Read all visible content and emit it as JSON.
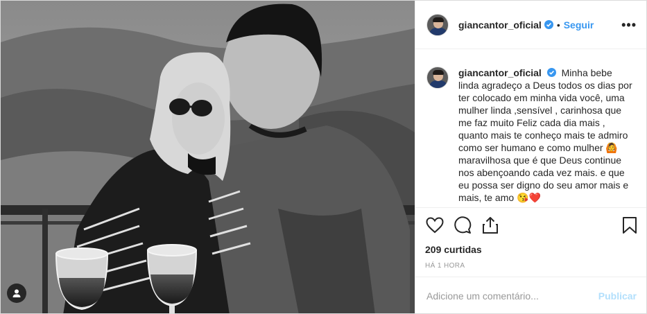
{
  "post": {
    "username": "giancantor_oficial",
    "follow_label": "Seguir",
    "separator": "•",
    "more_label": "•••",
    "caption": "Minha bebe linda agradeço a Deus todos os dias por ter colocado em minha vida você, uma mulher linda ,sensível , carinhosa que me faz muito Feliz cada dia mais , quanto mais te conheço mais te admiro como ser humano e como mulher 🙆 maravilhosa que é que Deus continue nos abençoando cada vez mais. e que eu possa ser digno do seu amor mais e mais, te amo 😘❤️",
    "likes": "209 curtidas",
    "timestamp": "HÁ 1 HORA"
  },
  "comment": {
    "placeholder": "Adicione um comentário...",
    "publish_label": "Publicar"
  },
  "icons": {
    "verified": "verified-badge-icon",
    "like": "heart-icon",
    "comment": "comment-icon",
    "share": "share-icon",
    "save": "bookmark-icon",
    "user_tag": "user-tag-icon"
  },
  "colors": {
    "follow": "#3897f0",
    "verified": "#3897f0",
    "publish_disabled": "#b2dffc",
    "muted": "#999999",
    "text": "#262626"
  }
}
